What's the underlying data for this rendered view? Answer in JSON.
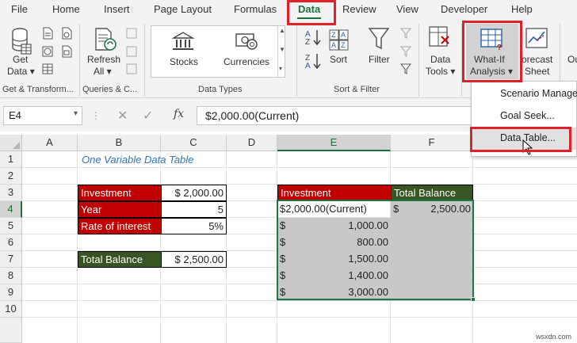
{
  "menu_tabs": [
    "File",
    "Home",
    "Insert",
    "Page Layout",
    "Formulas",
    "Data",
    "Review",
    "View",
    "Developer",
    "Help"
  ],
  "ribbon": {
    "get_data": "Get",
    "get_data2": "Data",
    "refresh": "Refresh",
    "refresh2": "All",
    "stocks": "Stocks",
    "currencies": "Currencies",
    "sort": "Sort",
    "filter": "Filter",
    "data_tools": "Data",
    "data_tools2": "Tools",
    "whatif": "What-If",
    "whatif2": "Analysis",
    "forecast": "orecast",
    "forecast2": "Sheet",
    "outline": "Ou",
    "groups": {
      "get_transform": "Get & Transform...",
      "queries": "Queries & C...",
      "data_types": "Data Types",
      "sort_filter": "Sort & Filter"
    }
  },
  "whatif_menu": {
    "scenario": "Scenario Manager...",
    "goal_seek": "Goal Seek...",
    "data_table": "Data Table..."
  },
  "formula_bar": {
    "name_box": "E4",
    "fx": "fx",
    "formula": "$2,000.00(Current)"
  },
  "columns": [
    "A",
    "B",
    "C",
    "D",
    "E",
    "F"
  ],
  "rows": [
    "1",
    "2",
    "3",
    "4",
    "5",
    "6",
    "7",
    "8",
    "9",
    "10"
  ],
  "sheet": {
    "title": "One Variable Data Table",
    "investment_label": "Investment",
    "investment_value": "$ 2,000.00",
    "year_label": "Year",
    "year_value": "5",
    "rate_label": "Rate of interest",
    "rate_value": "5%",
    "total_label": "Total Balance",
    "total_value": "$ 2,500.00",
    "table": {
      "header_investment": "Investment",
      "header_total": "Total Balance",
      "current": "$2,000.00(Current)",
      "current_total_sym": "$",
      "current_total": "2,500.00",
      "investments": [
        "1,000.00",
        "800.00",
        "1,500.00",
        "1,400.00",
        "3,000.00"
      ],
      "currency_symbol": "$"
    }
  },
  "watermark": "wsxdn.com",
  "colors": {
    "excel_green": "#217346",
    "header_red": "#c00000",
    "header_green": "#375623",
    "highlight_red": "#e0212b"
  }
}
